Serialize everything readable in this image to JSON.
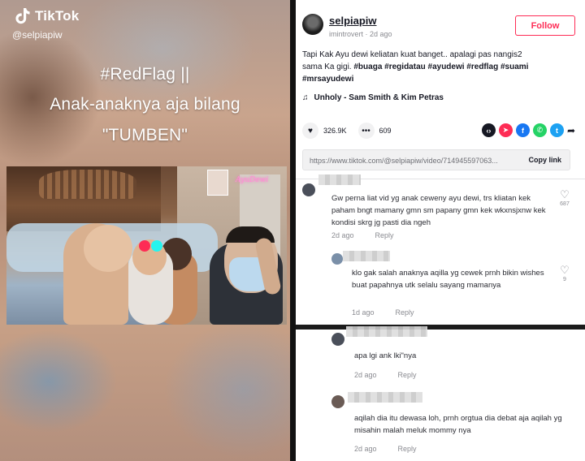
{
  "video": {
    "brand": "TikTok",
    "username": "@selpiapiw",
    "overlay_lines": [
      "#RedFlag ||",
      "Anak-anaknya aja bilang",
      "\"TUMBEN\""
    ],
    "neon_sign": "AyuDewi"
  },
  "post": {
    "username": "selpiapiw",
    "meta": "imintrovert · 2d ago",
    "follow_label": "Follow",
    "caption_text": "Tapi Kak Ayu dewi keliatan kuat banget.. apalagi pas nangis2 sama Ka gigi. ",
    "caption_tags": "#buaga #regidatau #ayudewi #redflag #suami #mrsayudewi",
    "music": "Unholy - Sam Smith & Kim Petras",
    "likes": "326.9K",
    "comments_count": "609",
    "link": "https://www.tiktok.com/@selpiapiw/video/714945597063...",
    "copy_link_label": "Copy link",
    "share_colors": {
      "embed": "#161823",
      "pinterest": "#fe2c55",
      "facebook": "#1877f2",
      "whatsapp": "#25d366",
      "twitter": "#1da1f2"
    }
  },
  "comments": [
    {
      "text": "Gw perna liat vid yg anak ceweny ayu dewi, trs kliatan kek paham bngt mamany gmn sm papany gmn kek wkxnsjxnw kek kondisi skrg jg pasti dia ngeh",
      "time": "2d ago",
      "reply": "Reply",
      "likes": "687"
    },
    {
      "text": "klo gak salah anaknya aqilla yg cewek prnh bikin wishes buat papahnya utk selalu sayang mamanya",
      "time": "1d ago",
      "reply": "Reply",
      "likes": "9"
    },
    {
      "text": "apa lgi ank lki\"nya",
      "time": "2d ago",
      "reply": "Reply"
    },
    {
      "text": "aqilah dia itu dewasa loh, prnh orgtua dia debat aja aqilah yg misahin malah meluk mommy nya",
      "time": "2d ago",
      "reply": "Reply"
    }
  ]
}
